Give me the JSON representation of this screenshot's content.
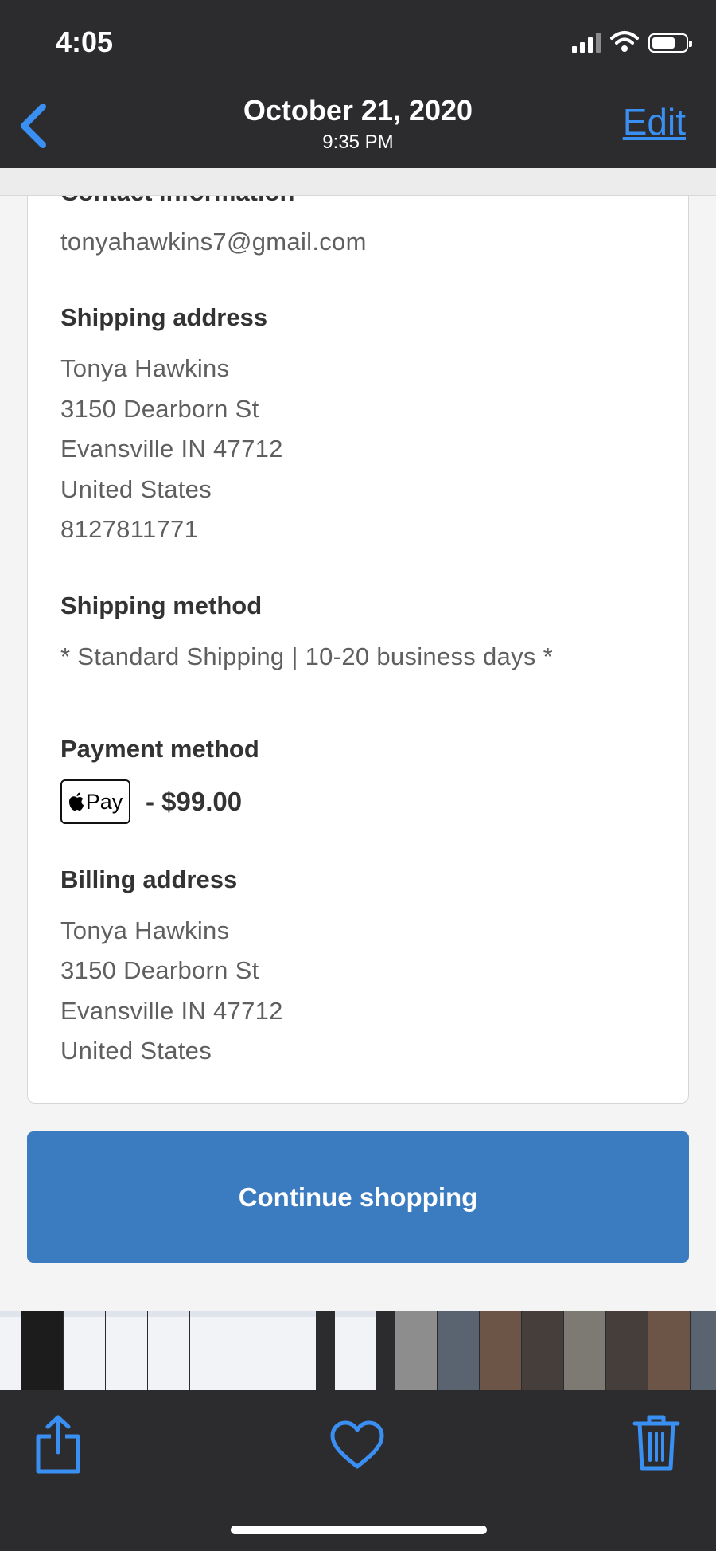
{
  "status_bar": {
    "time": "4:05"
  },
  "nav": {
    "title": "October 21, 2020",
    "subtitle": "9:35 PM",
    "edit_label": "Edit"
  },
  "order": {
    "contact_heading": "Contact information",
    "email": "tonyahawkins7@gmail.com",
    "shipping_address_heading": "Shipping address",
    "shipping_address": [
      "Tonya Hawkins",
      "3150 Dearborn St",
      "Evansville IN 47712",
      "United States",
      "8127811771"
    ],
    "shipping_method_heading": "Shipping method",
    "shipping_method": "* Standard Shipping | 10-20 business days *",
    "payment_method_heading": "Payment method",
    "payment_badge": "Pay",
    "payment_amount": "- $99.00",
    "billing_address_heading": "Billing address",
    "billing_address": [
      "Tonya Hawkins",
      "3150 Dearborn St",
      "Evansville IN 47712",
      "United States"
    ]
  },
  "cta": {
    "label": "Continue shopping"
  },
  "toolbar": {
    "share_icon": "share-icon",
    "favorite_icon": "heart-icon",
    "delete_icon": "trash-icon"
  },
  "colors": {
    "accent": "#3a8ff3",
    "button": "#3b7bbf",
    "bar": "#2c2c2e"
  }
}
